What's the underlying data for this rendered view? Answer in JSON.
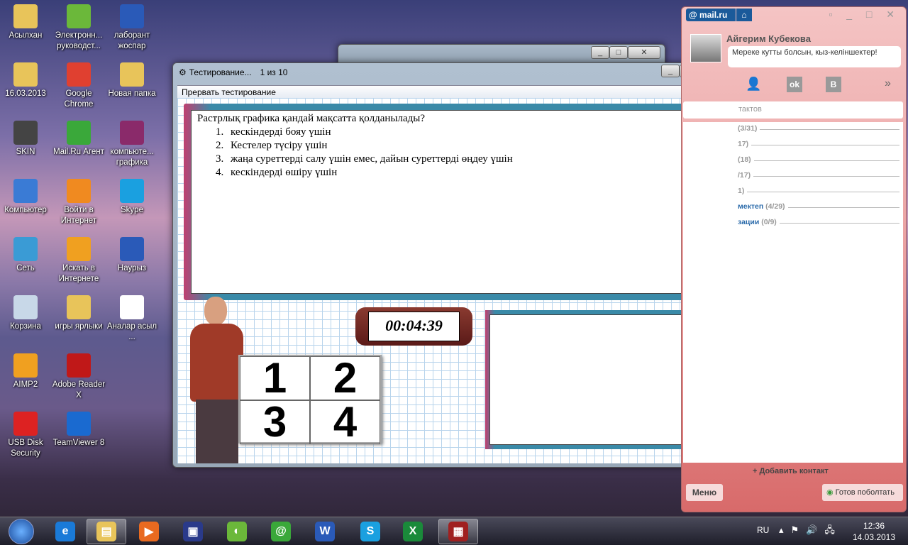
{
  "desktop": {
    "icons": [
      {
        "label": "Асылхан",
        "color": "#e8c45a"
      },
      {
        "label": "16.03.2013",
        "color": "#e8c45a"
      },
      {
        "label": "SKIN",
        "color": "#444"
      },
      {
        "label": "Компьютер",
        "color": "#3a7bd5"
      },
      {
        "label": "Сеть",
        "color": "#3a9bd5"
      },
      {
        "label": "Корзина",
        "color": "#c8d8e8"
      },
      {
        "label": "AIMP2",
        "color": "#f0a020"
      },
      {
        "label": "USB Disk Security",
        "color": "#d22"
      },
      {
        "label": "Электронн... руководст...",
        "color": "#6bb83a"
      },
      {
        "label": "Google Chrome",
        "color": "#e04030"
      },
      {
        "label": "Mail.Ru Агент",
        "color": "#3aa83a"
      },
      {
        "label": "Войти в Интернет",
        "color": "#f08a20"
      },
      {
        "label": "Искать в Интернете",
        "color": "#f0a020"
      },
      {
        "label": "игры ярлыки",
        "color": "#e8c45a"
      },
      {
        "label": "Adobe Reader X",
        "color": "#c01818"
      },
      {
        "label": "TeamViewer 8",
        "color": "#1a6ad0"
      },
      {
        "label": "лаборант жоспар",
        "color": "#2a5ab8"
      },
      {
        "label": "Новая папка",
        "color": "#e8c45a"
      },
      {
        "label": "компьюте... графика",
        "color": "#8a2a6a"
      },
      {
        "label": "Skype",
        "color": "#1aa0e0"
      },
      {
        "label": "Наурыз",
        "color": "#2a5ab8"
      },
      {
        "label": "Аналар асыл ...",
        "color": "#ffffff"
      }
    ]
  },
  "test_window": {
    "title": "Тестирование...",
    "progress": "1 из 10",
    "menu": "Прервать тестирование",
    "question": "Растрлық графика қандай мақсатта қолданылады?",
    "answers": [
      {
        "n": "1.",
        "text": "кескіндерді бояу үшін"
      },
      {
        "n": "2.",
        "text": "Кестелер түсіру үшін"
      },
      {
        "n": "3.",
        "text": "жаңа суреттерді салу үшін емес, дайын суреттерді өңдеу үшін"
      },
      {
        "n": "4.",
        "text": "кескіндерді өшіру үшін"
      }
    ],
    "timer": "00:04:39",
    "board": [
      "1",
      "2",
      "3",
      "4"
    ]
  },
  "mailru": {
    "logo": "@ mail.ru",
    "user": "Айгерим Кубекова",
    "status": "Мереке кутты болсын, кыз-келіншектер!",
    "search_placeholder": "тактов",
    "groups": [
      "(3/31)",
      "17)",
      "(18)",
      "/17)",
      "1)"
    ],
    "groups_named": [
      {
        "name": "мектеп",
        "count": "(4/29)"
      },
      {
        "name": "зации",
        "count": "(0/9)"
      }
    ],
    "add_contact": "Добавить контакт",
    "menu": "Меню",
    "ready": "Готов поболтать"
  },
  "taskbar": {
    "lang": "RU",
    "time": "12:36",
    "date": "14.03.2013",
    "apps": [
      {
        "name": "internet-explorer",
        "glyph": "e",
        "color": "#1a7ad8"
      },
      {
        "name": "explorer",
        "glyph": "▤",
        "color": "#e8c45a"
      },
      {
        "name": "media",
        "glyph": "▶",
        "color": "#e86a20"
      },
      {
        "name": "save",
        "glyph": "▣",
        "color": "#2a3a8a"
      },
      {
        "name": "browser",
        "glyph": "◐",
        "color": "#6bb83a"
      },
      {
        "name": "mail-agent",
        "glyph": "@",
        "color": "#3aa83a"
      },
      {
        "name": "word",
        "glyph": "W",
        "color": "#2a5ab8"
      },
      {
        "name": "skype",
        "glyph": "S",
        "color": "#1aa0e0"
      },
      {
        "name": "excel",
        "glyph": "X",
        "color": "#1a8a3a"
      },
      {
        "name": "test-app",
        "glyph": "▦",
        "color": "#a02020"
      }
    ]
  }
}
